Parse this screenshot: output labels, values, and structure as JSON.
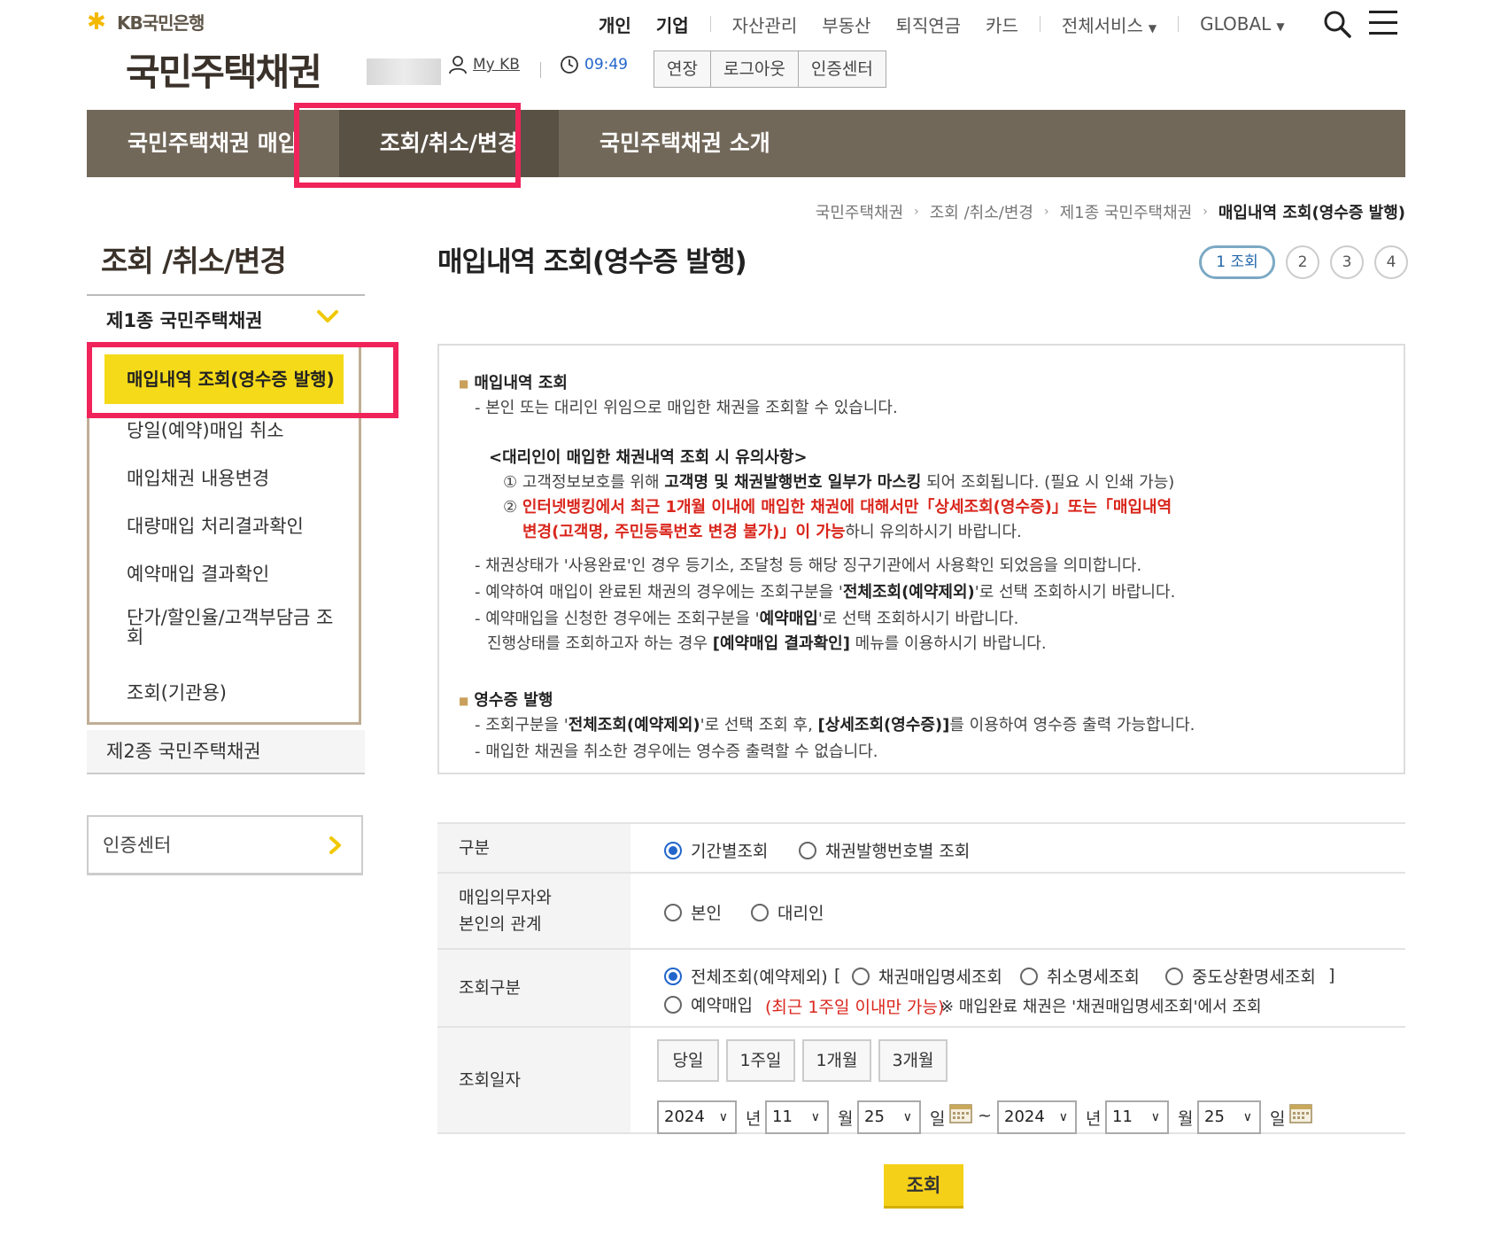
{
  "header": {
    "logo_text": "KB국민은행",
    "site_title": "국민주택채권",
    "gnb": [
      "개인",
      "기업",
      "자산관리",
      "부동산",
      "퇴직연금",
      "카드",
      "전체서비스",
      "GLOBAL"
    ],
    "mykb_label": "My KB",
    "timer": "09:49",
    "session_buttons": [
      "연장",
      "로그아웃",
      "인증센터"
    ]
  },
  "mainnav": [
    "국민주택채권 매입",
    "조회/취소/변경",
    "국민주택채권 소개"
  ],
  "breadcrumb": [
    "국민주택채권",
    "조회 /취소/변경",
    "제1종 국민주택채권",
    "매입내역 조회(영수증 발행)"
  ],
  "sidebar": {
    "title": "조회 /취소/변경",
    "group1": "제1종 국민주택채권",
    "items": [
      "매입내역 조회(영수증 발행)",
      "당일(예약)매입 취소",
      "매입채권 내용변경",
      "대량매입 처리결과확인",
      "예약매입 결과확인",
      "단가/할인율/고객부담금 조회",
      "조회(기관용)"
    ],
    "group2": "제2종 국민주택채권",
    "cert_center": "인증센터"
  },
  "page": {
    "title": "매입내역 조회(영수증 발행)",
    "steps": [
      "1 조회",
      "2",
      "3",
      "4"
    ]
  },
  "info": {
    "sec1_title": "매입내역 조회",
    "sec1_l1": "- 본인 또는 대리인 위임으로 매입한 채권을 조회할 수 있습니다.",
    "notice_title": "<대리인이 매입한 채권내역 조회 시 유의사항>",
    "n1_pre": "① 고객정보보호를 위해 ",
    "n1_bold": "고객명 및 채권발행번호 일부가 마스킹",
    "n1_post": " 되어 조회됩니다. (필요 시 인쇄 가능)",
    "n2_red1": "인터넷뱅킹에서 최근 1개월 이내에 매입한 채권에 대해서만「상세조회(영수증)」또는「매입내역",
    "n2_red2": "변경(고객명, 주민등록번호 변경 불가)」이 가능",
    "n2_post": "하니 유의하시기 바랍니다.",
    "n2_mark": "②",
    "l2": "- 채권상태가 '사용완료'인 경우 등기소, 조달청 등 해당 징구기관에서 사용확인 되었음을 의미합니다.",
    "l3_pre": "- 예약하여 매입이 완료된 채권의 경우에는 조회구분을 '",
    "l3_bold": "전체조회(예약제외)",
    "l3_post": "'로 선택 조회하시기 바랍니다.",
    "l4_pre": "- 예약매입을 신청한 경우에는 조회구분을 '",
    "l4_bold": "예약매입",
    "l4_post": "'로 선택 조회하시기 바랍니다.",
    "l5_pre": "진행상태를 조회하고자 하는 경우 ",
    "l5_bold": "[예약매입 결과확인]",
    "l5_post": " 메뉴를 이용하시기 바랍니다.",
    "sec2_title": "영수증 발행",
    "r1_pre": "- 조회구분을 '",
    "r1_bold1": "전체조회(예약제외)",
    "r1_mid": "'로 선택 조회 후, ",
    "r1_bold2": "[상세조회(영수증)]",
    "r1_post": "를 이용하여 영수증 출력 가능합니다.",
    "r2": "- 매입한 채권을 취소한 경우에는 영수증 출력할 수 없습니다."
  },
  "form": {
    "row1_label": "구분",
    "row1_opts": [
      "기간별조회",
      "채권발행번호별 조회"
    ],
    "row2_label_l1": "매입의무자와",
    "row2_label_l2": "본인의 관계",
    "row2_opts": [
      "본인",
      "대리인"
    ],
    "row3_label": "조회구분",
    "row3_opt_all": "전체조회(예약제외)",
    "row3_bracket_open": "[",
    "row3_sub_opts": [
      "채권매입명세조회",
      "취소명세조회",
      "중도상환명세조회"
    ],
    "row3_bracket_close": "]",
    "row3_opt_resv": "예약매입",
    "row3_resv_note": "(최근 1주일 이내만 가능)",
    "row3_note": "※ 매입완료 채권은 '채권매입명세조회'에서 조회",
    "row4_label": "조회일자",
    "quick_buttons": [
      "당일",
      "1주일",
      "1개월",
      "3개월"
    ],
    "from": {
      "year": "2024",
      "month": "11",
      "day": "25"
    },
    "to": {
      "year": "2024",
      "month": "11",
      "day": "25"
    },
    "unit_year": "년",
    "unit_month": "월",
    "unit_day": "일",
    "tilde": "~"
  },
  "search_button": "조회",
  "colors": {
    "nav_bg": "#72685a",
    "highlight": "#f5da1a",
    "annotation_red": "#f0235a",
    "accent_blue": "#2266cc"
  }
}
